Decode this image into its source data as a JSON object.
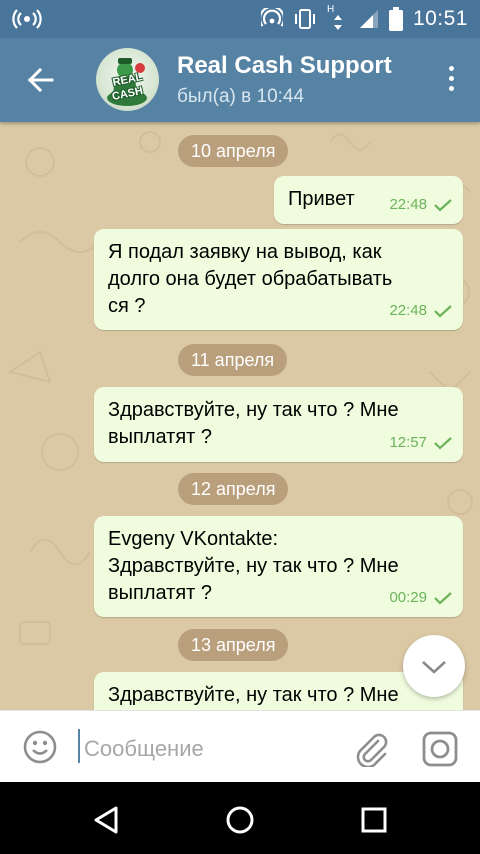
{
  "status_bar": {
    "time": "10:51",
    "network_label": "H"
  },
  "header": {
    "title": "Real Cash Support",
    "subtitle": "был(а) в 10:44",
    "avatar_text_line1": "REAL",
    "avatar_text_line2": "CASH"
  },
  "messages": [
    {
      "type": "date",
      "text": "10 апреля"
    },
    {
      "type": "msg",
      "text": "Привет",
      "time": "22:48",
      "status": "read"
    },
    {
      "type": "msg",
      "text": "Я подал заявку на вывод, как\nдолго она будет обрабатывать\nся ?",
      "time": "22:48",
      "status": "read"
    },
    {
      "type": "date",
      "text": "11 апреля"
    },
    {
      "type": "msg",
      "text": "Здравствуйте, ну так что ? Мне\nвыплатят ?",
      "time": "12:57",
      "status": "read"
    },
    {
      "type": "date",
      "text": "12 апреля"
    },
    {
      "type": "msg",
      "text": "Evgeny VKontakte:\nЗдравствуйте, ну так что ? Мне\nвыплатят ?",
      "time": "00:29",
      "status": "read"
    },
    {
      "type": "date",
      "text": "13 апреля"
    },
    {
      "type": "msg",
      "text": "Здравствуйте, ну так что ? Мне",
      "time": "",
      "status": "read"
    }
  ],
  "input": {
    "placeholder": "Сообщение",
    "value": ""
  },
  "colors": {
    "header": "#5682a3",
    "status_bar": "#4a759b",
    "chat_background": "#dbc9a5",
    "bubble_out": "#effdde",
    "date_pill": "#b99f7c",
    "check": "#6cb25a"
  },
  "icons": {
    "back": "arrow-left-icon",
    "menu": "more-vertical-icon",
    "emoji": "smile-icon",
    "attach": "paperclip-icon",
    "camera": "instagram-camera-icon",
    "scroll_down": "chevron-down-icon",
    "nav_back": "triangle-back-icon",
    "nav_home": "circle-home-icon",
    "nav_recents": "square-recents-icon"
  }
}
